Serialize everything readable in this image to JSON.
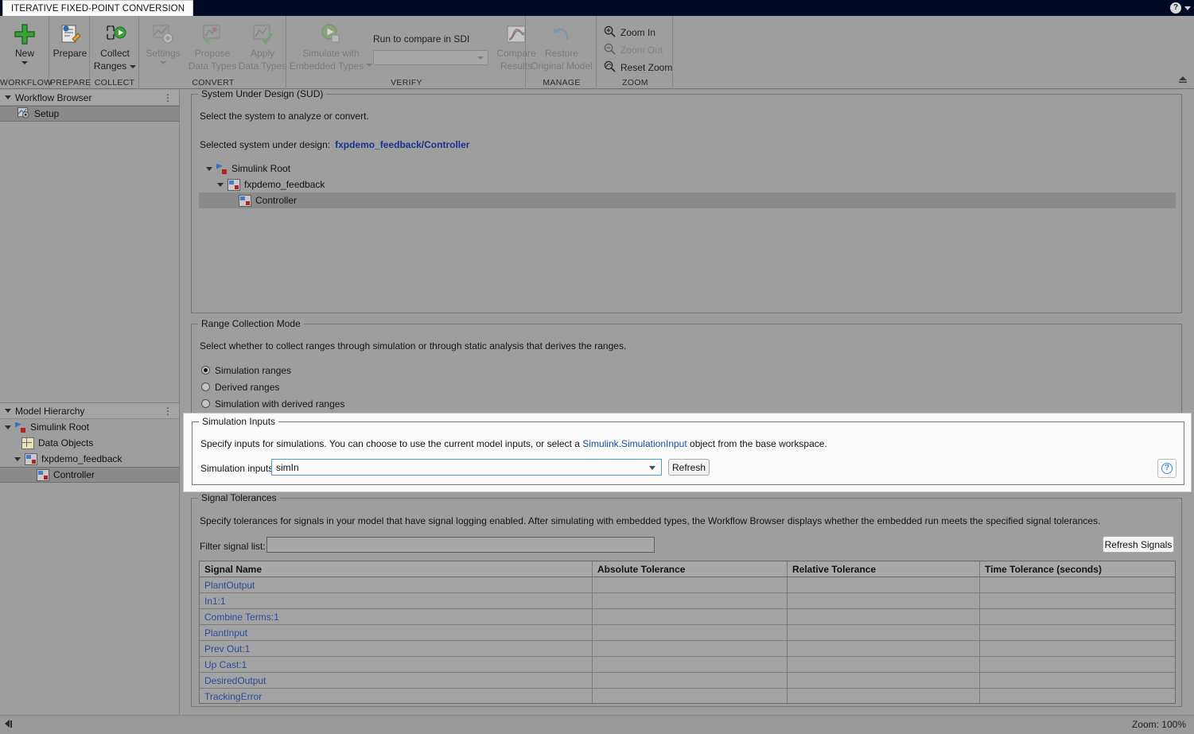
{
  "titlebar": {
    "tab_label": "ITERATIVE FIXED-POINT CONVERSION",
    "help_icon": "help-circle-icon",
    "help_caret": "chevron-down-icon"
  },
  "ribbon": {
    "groups": [
      {
        "name": "WORKFLOW"
      },
      {
        "name": "PREPARE"
      },
      {
        "name": "COLLECT"
      },
      {
        "name": "CONVERT"
      },
      {
        "name": "VERIFY"
      },
      {
        "name": "MANAGE"
      },
      {
        "name": "ZOOM"
      }
    ],
    "items": {
      "new": {
        "label": "New",
        "icon": "plus-icon"
      },
      "prepare": {
        "label": "Prepare",
        "icon": "document-edit-icon"
      },
      "collect_ranges": {
        "label_1": "Collect",
        "label_2": "Ranges",
        "icon": "collect-ranges-icon"
      },
      "settings": {
        "label": "Settings",
        "icon": "gear-icon"
      },
      "propose": {
        "label_1": "Propose",
        "label_2": "Data Types",
        "icon": "propose-icon"
      },
      "apply": {
        "label_1": "Apply",
        "label_2": "Data Types",
        "icon": "apply-check-icon"
      },
      "simulate_embedded": {
        "label_1": "Simulate with",
        "label_2": "Embedded Types",
        "icon": "run-icon"
      },
      "sdi_label": "Run to compare in SDI",
      "sdi_combo_value": "",
      "compare_results": {
        "label_1": "Compare",
        "label_2": "Results",
        "icon": "compare-plot-icon"
      },
      "restore_model": {
        "label_1": "Restore",
        "label_2": "Original Model",
        "icon": "undo-icon"
      },
      "zoom_in": {
        "label": "Zoom In",
        "icon": "zoom-in-icon"
      },
      "zoom_out": {
        "label": "Zoom Out",
        "icon": "zoom-out-icon"
      },
      "reset_zoom": {
        "label": "Reset Zoom",
        "icon": "reset-zoom-icon"
      },
      "collapse_ribbon": "collapse-ribbon-icon"
    }
  },
  "workflow_browser": {
    "title": "Workflow Browser",
    "overflow_icon": "more-vertical-icon",
    "items": [
      {
        "label": "Setup",
        "icon": "setup-icon",
        "selected": true
      }
    ]
  },
  "model_hierarchy": {
    "title": "Model Hierarchy",
    "overflow_icon": "more-vertical-icon",
    "items": [
      {
        "label": "Simulink Root",
        "icon": "simulink-root-icon",
        "indent": 0,
        "expanded": true,
        "selected": false
      },
      {
        "label": "Data Objects",
        "icon": "data-objects-icon",
        "indent": 1,
        "expanded": null,
        "selected": false
      },
      {
        "label": "fxpdemo_feedback",
        "icon": "subsystem-icon",
        "indent": 1,
        "expanded": true,
        "selected": false
      },
      {
        "label": "Controller",
        "icon": "subsystem-icon",
        "indent": 2,
        "expanded": null,
        "selected": true
      }
    ]
  },
  "sud": {
    "legend": "System Under Design (SUD)",
    "description": "Select the system to analyze or convert.",
    "selected_label": "Selected system under design:",
    "selected_value": "fxpdemo_feedback/Controller",
    "tree": [
      {
        "label": "Simulink Root",
        "icon": "simulink-root-icon",
        "indent": 0,
        "expanded": true,
        "selected": false
      },
      {
        "label": "fxpdemo_feedback",
        "icon": "subsystem-icon",
        "indent": 1,
        "expanded": true,
        "selected": false
      },
      {
        "label": "Controller",
        "icon": "subsystem-icon",
        "indent": 2,
        "expanded": null,
        "selected": true
      }
    ]
  },
  "range_mode": {
    "legend": "Range Collection Mode",
    "description": "Select whether to collect ranges through simulation or through static analysis that derives the ranges.",
    "options": [
      {
        "label": "Simulation ranges",
        "selected": true
      },
      {
        "label": "Derived ranges",
        "selected": false
      },
      {
        "label": "Simulation with derived ranges",
        "selected": false
      }
    ]
  },
  "simulation_inputs": {
    "legend": "Simulation Inputs",
    "description_part1": "Specify inputs for simulations. You can choose to use the current model inputs, or select a ",
    "description_link": "Simulink.SimulationInput",
    "description_part2": " object from the base workspace.",
    "field_label": "Simulation inputs:",
    "field_value": "simIn",
    "refresh_label": "Refresh",
    "help_icon": "help-circle-icon",
    "accent_color": "#4d9be0"
  },
  "signal_tolerances": {
    "legend": "Signal Tolerances",
    "description": "Specify tolerances for signals in your model that have signal logging enabled. After simulating with embedded types, the Workflow Browser displays whether the embedded run meets the specified signal tolerances.",
    "filter_label": "Filter signal list:",
    "filter_value": "",
    "refresh_signals_label": "Refresh Signals",
    "columns": [
      "Signal Name",
      "Absolute Tolerance",
      "Relative Tolerance",
      "Time Tolerance (seconds)"
    ],
    "rows": [
      {
        "signal_name": "PlantOutput",
        "absolute": "",
        "relative": "",
        "time": ""
      },
      {
        "signal_name": "In1:1",
        "absolute": "",
        "relative": "",
        "time": ""
      },
      {
        "signal_name": "Combine Terms:1",
        "absolute": "",
        "relative": "",
        "time": ""
      },
      {
        "signal_name": "PlantInput",
        "absolute": "",
        "relative": "",
        "time": ""
      },
      {
        "signal_name": "Prev Out:1",
        "absolute": "",
        "relative": "",
        "time": ""
      },
      {
        "signal_name": "Up Cast:1",
        "absolute": "",
        "relative": "",
        "time": ""
      },
      {
        "signal_name": "DesiredOutput",
        "absolute": "",
        "relative": "",
        "time": ""
      },
      {
        "signal_name": "TrackingError",
        "absolute": "",
        "relative": "",
        "time": ""
      }
    ]
  },
  "statusbar": {
    "collapse_icon": "collapse-panel-icon",
    "zoom_text": "Zoom: 100%"
  }
}
